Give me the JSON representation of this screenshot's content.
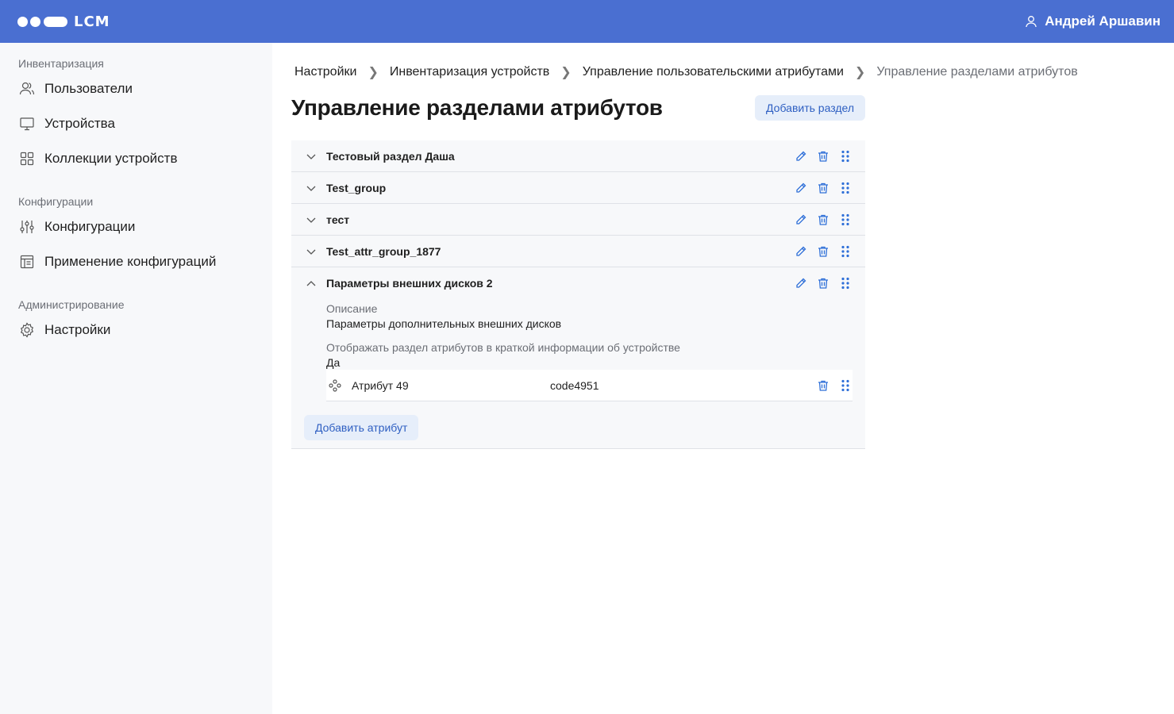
{
  "header": {
    "brand": "LCM",
    "user_name": "Андрей Аршавин"
  },
  "sidebar": {
    "sections": [
      {
        "title": "Инвентаризация",
        "items": [
          {
            "label": "Пользователи",
            "icon": "users-icon"
          },
          {
            "label": "Устройства",
            "icon": "monitor-icon"
          },
          {
            "label": "Коллекции устройств",
            "icon": "grid-icon"
          }
        ]
      },
      {
        "title": "Конфигурации",
        "items": [
          {
            "label": "Конфигурации",
            "icon": "sliders-icon"
          },
          {
            "label": "Применение конфигураций",
            "icon": "layout-icon"
          }
        ]
      },
      {
        "title": "Администрирование",
        "items": [
          {
            "label": "Настройки",
            "icon": "gear-icon"
          }
        ]
      }
    ]
  },
  "breadcrumb": [
    "Настройки",
    "Инвентаризация устройств",
    "Управление пользовательскими атрибутами",
    "Управление разделами атрибутов"
  ],
  "page": {
    "title": "Управление разделами атрибутов",
    "add_section_label": "Добавить раздел"
  },
  "sections": [
    {
      "name": "Тестовый раздел Даша",
      "expanded": false
    },
    {
      "name": "Test_group",
      "expanded": false
    },
    {
      "name": "тест",
      "expanded": false
    },
    {
      "name": "Test_attr_group_1877",
      "expanded": false
    },
    {
      "name": "Параметры внешних дисков 2",
      "expanded": true
    }
  ],
  "expanded_section": {
    "description_label": "Описание",
    "description_value": "Параметры дополнительных внешних дисков",
    "show_label": "Отображать раздел атрибутов в краткой информации об устройстве",
    "show_value": "Да",
    "attributes": [
      {
        "name": "Атрибут 49",
        "code": "code4951"
      }
    ],
    "add_attribute_label": "Добавить атрибут"
  },
  "colors": {
    "accent": "#4a6fd1",
    "icon_blue": "#2e6fd8",
    "sidebar_bg": "#f7f8fa"
  }
}
